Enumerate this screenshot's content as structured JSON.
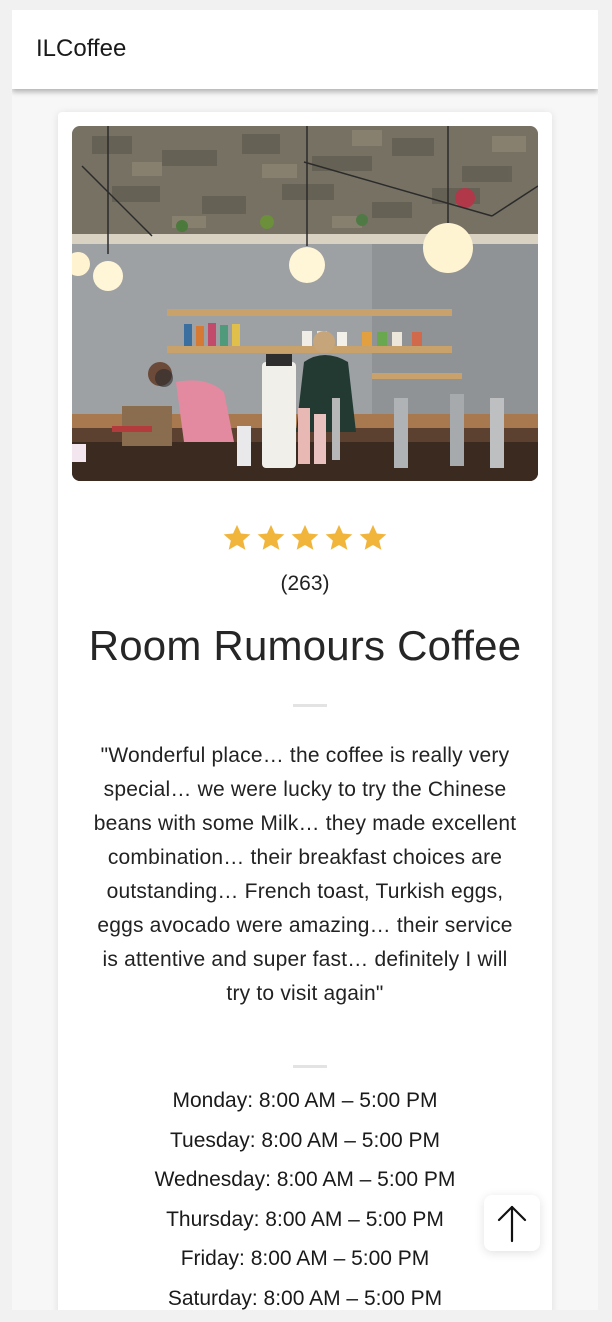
{
  "app": {
    "title": "ILCoffee"
  },
  "place": {
    "photo_alt": "Coffee shop interior",
    "rating": 5,
    "rating_max": 5,
    "review_count": "(263)",
    "name": "Room Rumours Coffee",
    "review": "\"Wonderful place… the coffee is really very special… we were lucky to try the Chinese beans with some Milk… they made excellent combination… their breakfast choices are outstanding… French toast, Turkish eggs, eggs avocado were amazing… their service is attentive and super fast… definitely I will try to visit again\"",
    "hours": [
      "Monday: 8:00 AM – 5:00 PM",
      "Tuesday: 8:00 AM – 5:00 PM",
      "Wednesday: 8:00 AM – 5:00 PM",
      "Thursday: 8:00 AM – 5:00 PM",
      "Friday: 8:00 AM – 5:00 PM",
      "Saturday: 8:00 AM – 5:00 PM"
    ]
  },
  "colors": {
    "star": "#f2b53c",
    "appbar": "#ffffff",
    "background": "#f7f7f7"
  },
  "icons": {
    "star": "star-icon",
    "scroll_top": "arrow-up-icon"
  }
}
